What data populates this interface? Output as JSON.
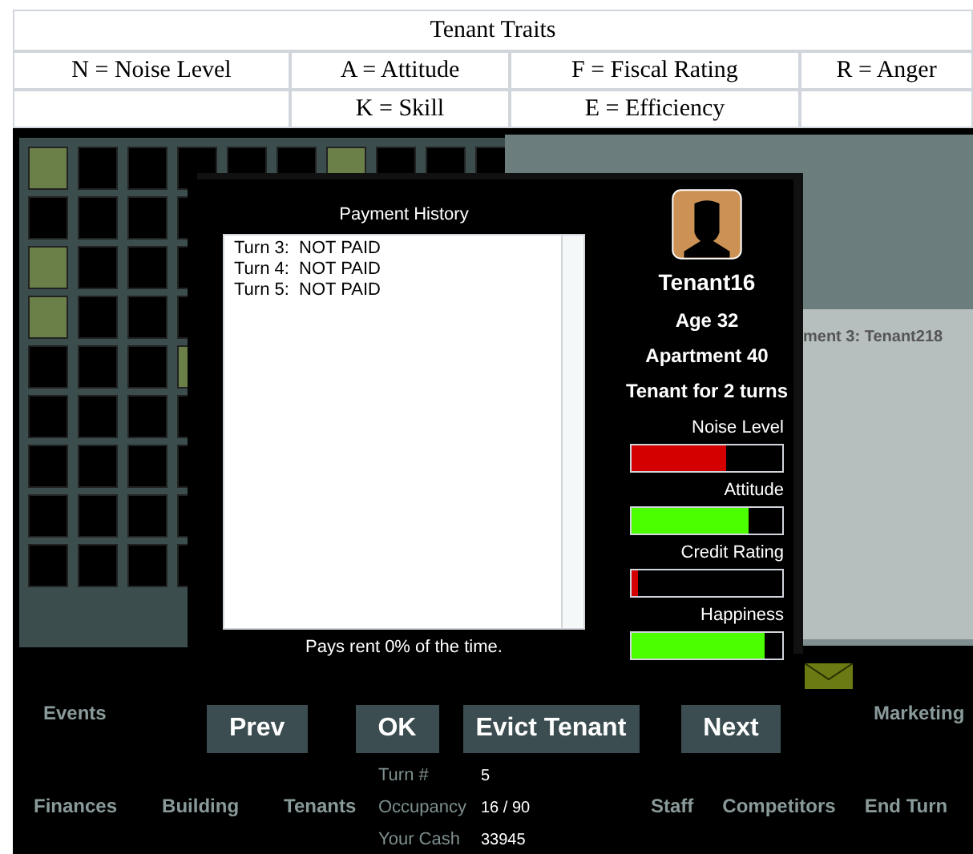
{
  "traits_table": {
    "title": "Tenant Traits",
    "rows": [
      [
        "N = Noise Level",
        "A = Attitude",
        "F = Fiscal Rating",
        "R = Anger"
      ],
      [
        "",
        "K = Skill",
        "E = Efficiency",
        ""
      ]
    ]
  },
  "side_panel": {
    "text": "ment 3: Tenant218"
  },
  "dialog": {
    "history_title": "Payment History",
    "history": [
      "Turn 3:  NOT PAID",
      "Turn 4:  NOT PAID",
      "Turn 5:  NOT PAID"
    ],
    "pays_text": "Pays rent 0% of the time.",
    "name": "Tenant16",
    "age": "Age 32",
    "apartment": "Apartment 40",
    "tenure": "Tenant for 2 turns",
    "meters": [
      {
        "label": "Noise Level",
        "level": 0.63,
        "color": "#d40000"
      },
      {
        "label": "Attitude",
        "level": 0.78,
        "color": "#4cff00"
      },
      {
        "label": "Credit Rating",
        "level": 0.04,
        "color": "#d40000"
      },
      {
        "label": "Happiness",
        "level": 0.88,
        "color": "#4cff00"
      }
    ],
    "buttons": [
      "Prev",
      "OK",
      "Evict Tenant",
      "Next"
    ]
  },
  "menu": {
    "top_left": "Events",
    "top_right": "Marketing",
    "left_items": [
      "Finances",
      "Building",
      "Tenants"
    ],
    "stats": [
      {
        "label": "Turn #",
        "value": "5"
      },
      {
        "label": "Occupancy",
        "value": "16 / 90"
      },
      {
        "label": "Your Cash",
        "value": "33945"
      }
    ],
    "right_items": [
      "Staff",
      "Competitors",
      "End Turn"
    ]
  }
}
